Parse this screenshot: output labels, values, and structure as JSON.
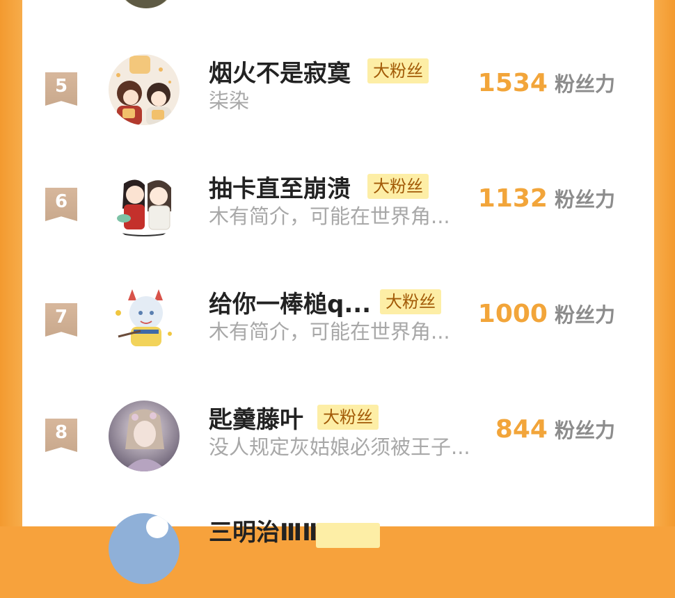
{
  "colors": {
    "side_orange": "#f7a23c",
    "rank_flag": "#cfaf93",
    "score_orange": "#f2a53a",
    "badge_bg": "#fdeea6",
    "badge_text": "#a25a07"
  },
  "rows": [
    {
      "rank": "5",
      "name": "烟火不是寂寞",
      "badge": "大粉丝",
      "desc": "柒染",
      "score": "1534",
      "unit": "粉丝力"
    },
    {
      "rank": "6",
      "name": "抽卡直至崩溃",
      "badge": "大粉丝",
      "desc": "木有简介，可能在世界角...",
      "score": "1132",
      "unit": "粉丝力"
    },
    {
      "rank": "7",
      "name": "给你一棒槌q...",
      "badge": "大粉丝",
      "desc": "木有简介，可能在世界角...",
      "score": "1000",
      "unit": "粉丝力"
    },
    {
      "rank": "8",
      "name": "匙羹藤叶",
      "badge": "大粉丝",
      "desc": "没人规定灰姑娘必须被王子...",
      "score": "844",
      "unit": "粉丝力"
    },
    {
      "name": "三明治ⅢⅢ"
    }
  ]
}
